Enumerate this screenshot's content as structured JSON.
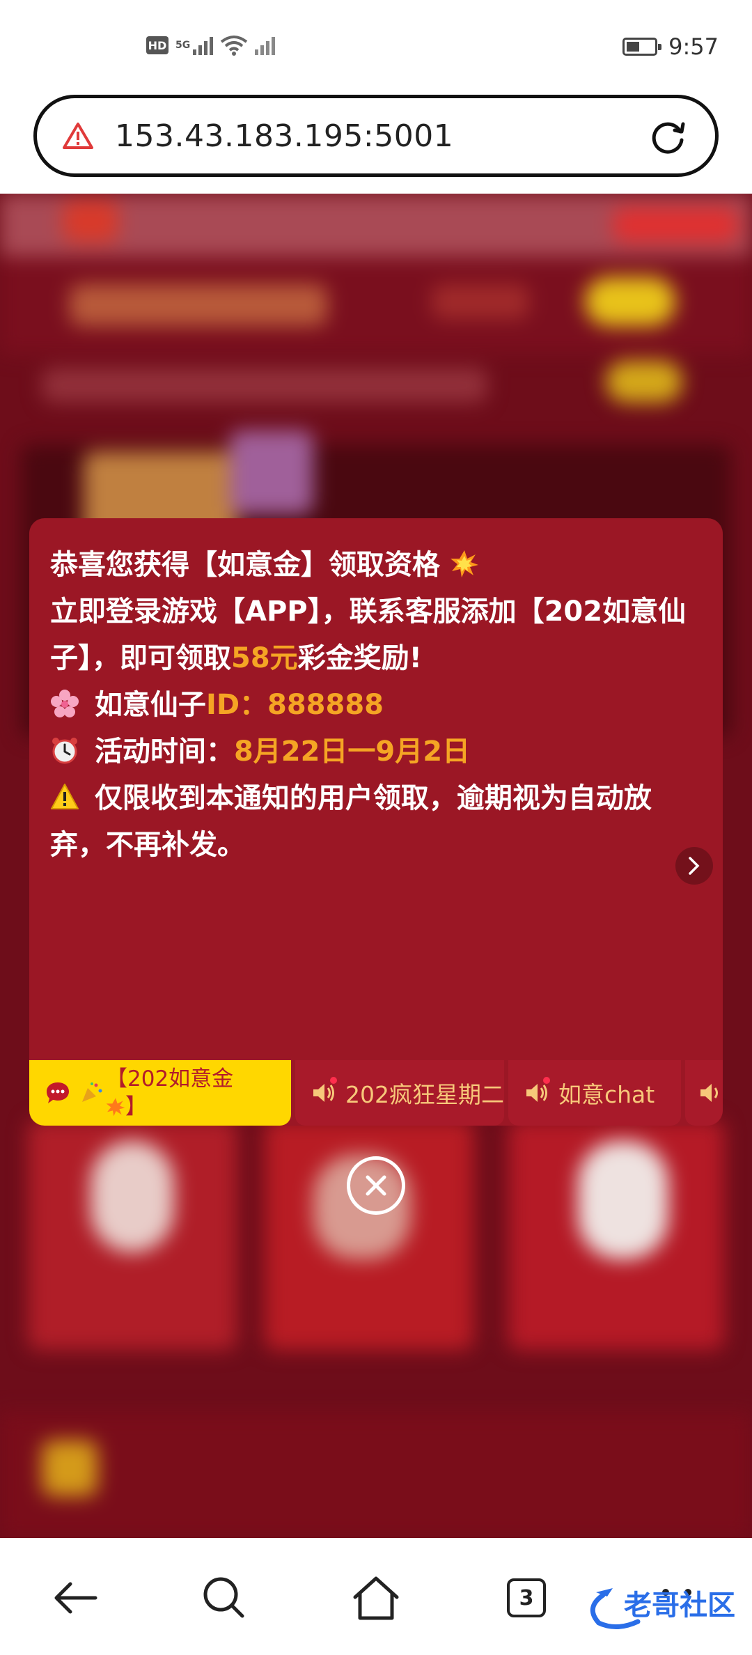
{
  "status_bar": {
    "hd": "HD",
    "net": "5G",
    "time": "9:57"
  },
  "browser": {
    "url": "153.43.183.195:5001"
  },
  "notice": {
    "line1": "恭喜您获得【如意金】领取资格",
    "line2_pre": "立即登录游戏【APP】，联系客服添加【202如意仙子】，即可领取",
    "line2_amount": "58元",
    "line2_post": "彩金奖励!",
    "line3_pre": "如意仙子",
    "line3_id": "ID：888888",
    "line4_pre": "活动时间：",
    "line4_dates": "8月22日一9月2日",
    "line5": "仅限收到本通知的用户领取，逾期视为自动放弃，不再补发。"
  },
  "tabs": [
    {
      "label": "【202如意金",
      "label_line2": "】",
      "active": true
    },
    {
      "label": "202疯狂星期二",
      "active": false
    },
    {
      "label": "如意chat",
      "active": false
    }
  ],
  "bottom_nav": {
    "tab_count": "3",
    "watermark_text": "老哥社区"
  },
  "colors": {
    "modal_bg": "#9b1725",
    "highlight": "#f5a524",
    "active_tab": "#ffd700",
    "page_bg": "#6e0d1a"
  }
}
